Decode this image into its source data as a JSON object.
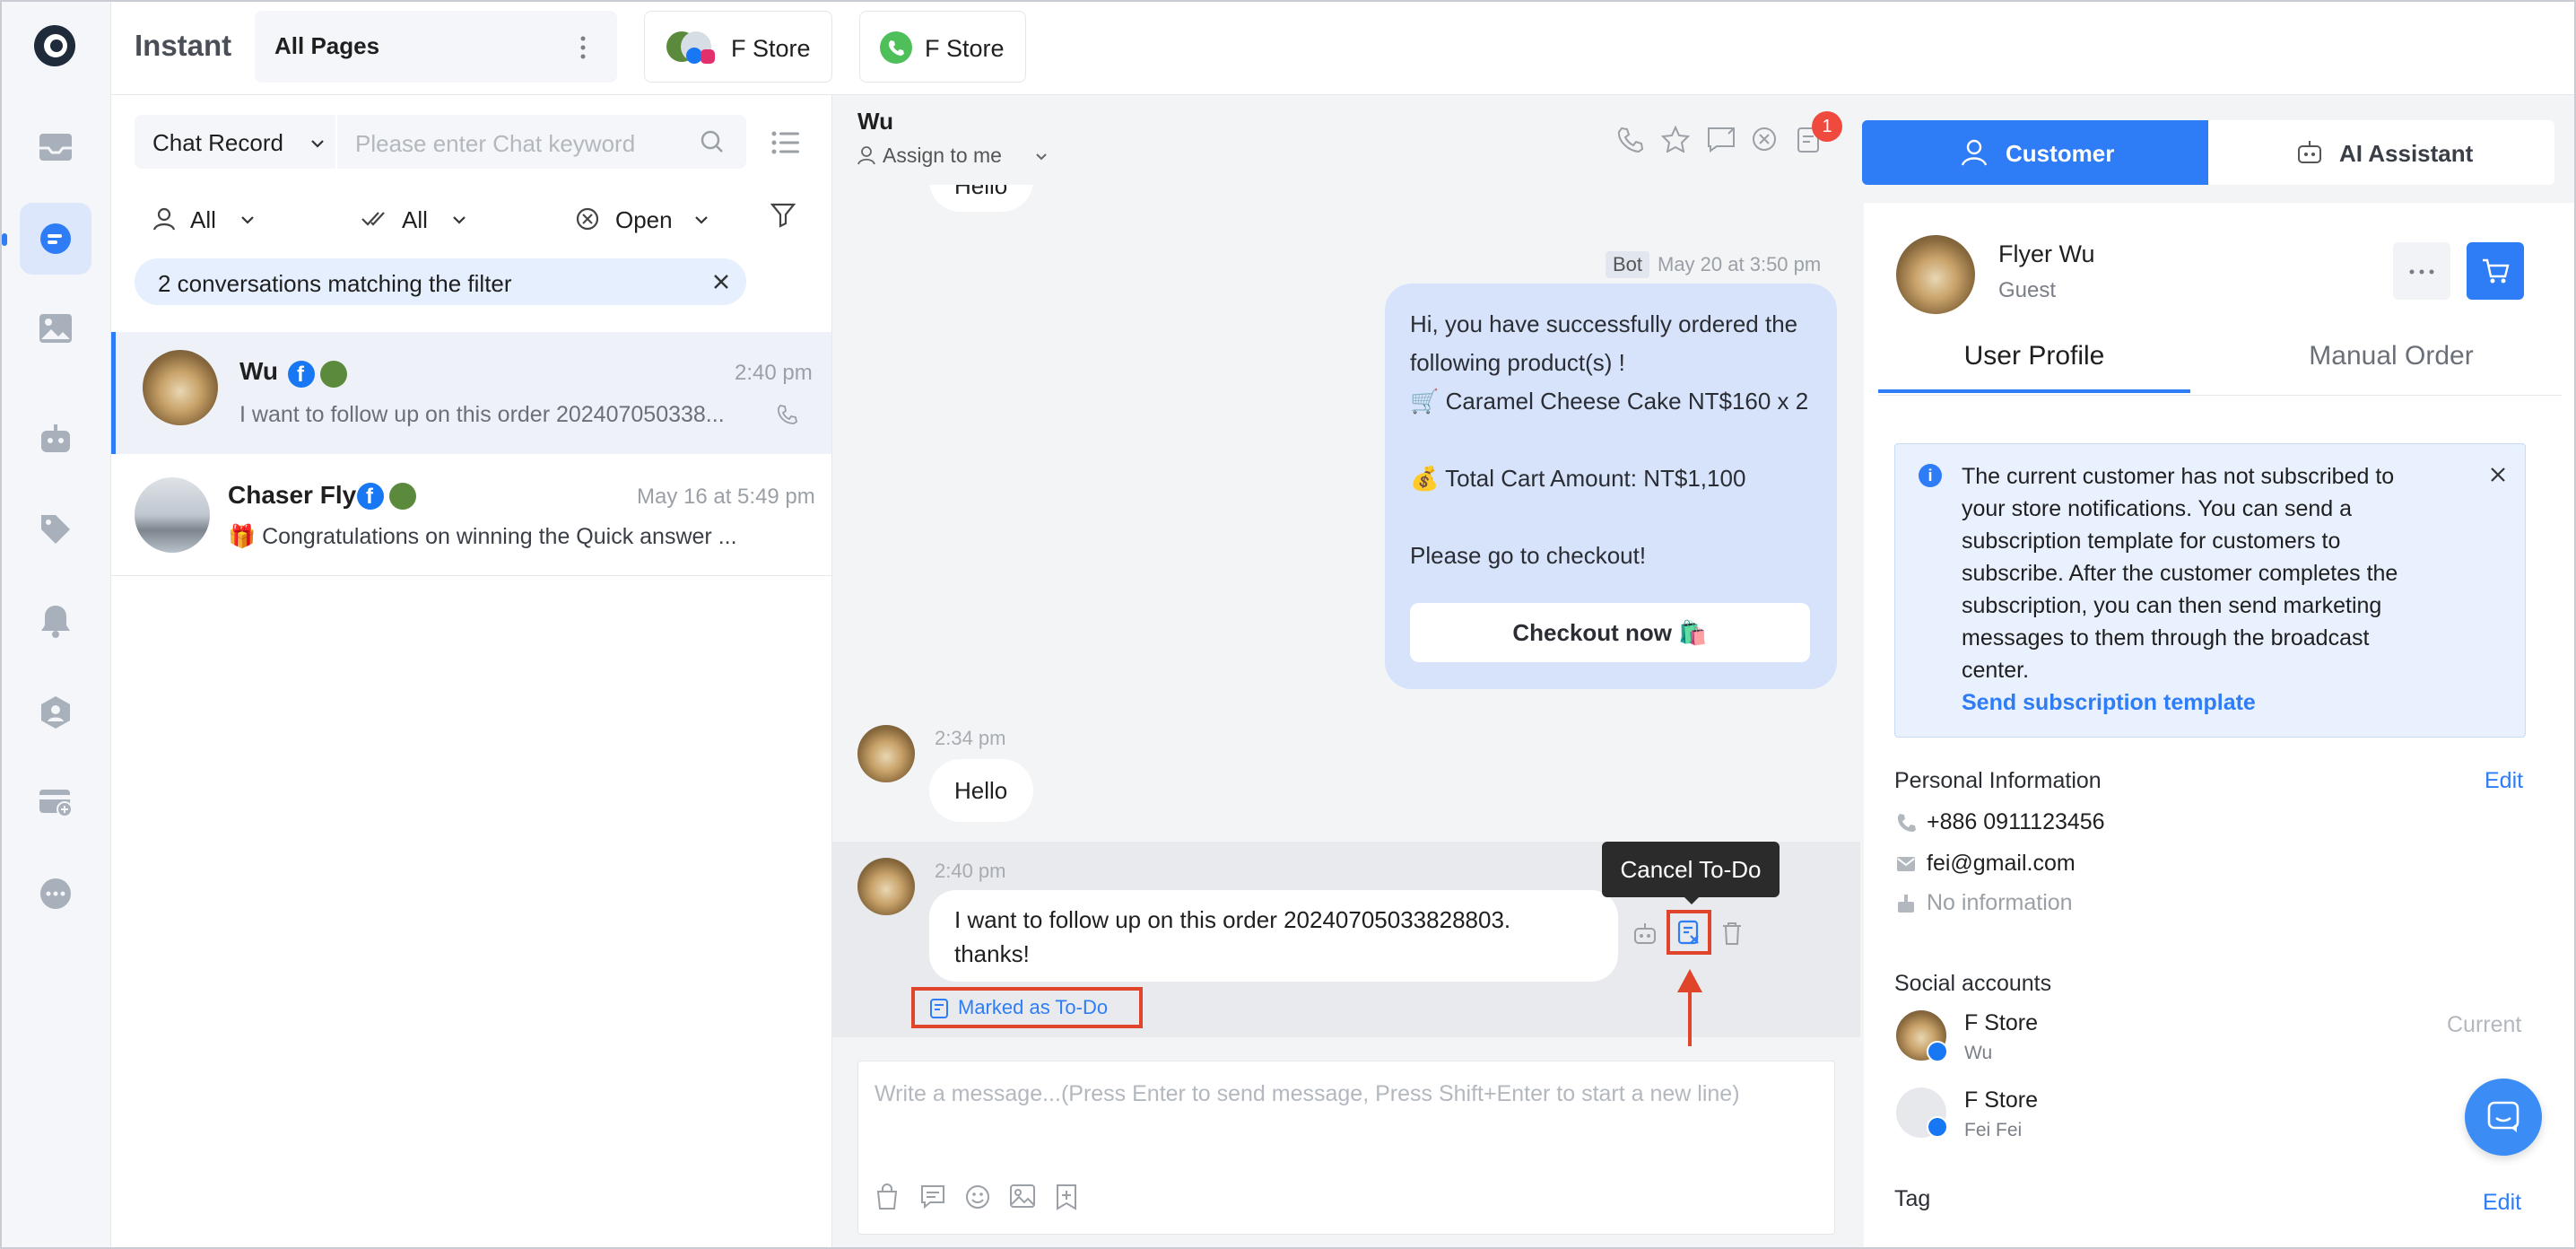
{
  "app": {
    "title": "Instant"
  },
  "top_tabs": {
    "pages_label": "All Pages",
    "store_tab_1": "F Store",
    "store_tab_2": "F Store"
  },
  "sidebar_icons": [
    "inbox-icon",
    "chat-icon",
    "image-icon",
    "bot-icon",
    "tag-icon",
    "bell-icon",
    "team-icon",
    "store-add-icon",
    "more-icon"
  ],
  "list_panel": {
    "record_type": "Chat Record",
    "search_placeholder": "Please enter Chat keyword",
    "filter_assignee": "All",
    "filter_read": "All",
    "filter_status": "Open",
    "match_banner": "2 conversations matching the filter",
    "conversations": [
      {
        "name": "Wu",
        "time": "2:40 pm",
        "preview": "I want to follow up on this order 202407050338..."
      },
      {
        "name": "Chaser Fly",
        "time": "May 16 at 5:49 pm",
        "preview": "🎁 Congratulations on winning the Quick answer   ..."
      }
    ]
  },
  "chat": {
    "contact_name": "Wu",
    "assign_label": "Assign to me",
    "todo_badge": "1",
    "top_bubble_fragment": "Hello",
    "bot_tag": "Bot",
    "bot_time": "May 20 at 3:50 pm",
    "bot_lines": [
      "Hi, you have successfully ordered the",
      "following product(s) !",
      "🛒 Caramel Cheese Cake NT$160 x 2",
      "💰 Total Cart Amount: NT$1,100",
      "Please go to checkout!"
    ],
    "checkout_button": "Checkout now 🛍️",
    "msg1_time": "2:34 pm",
    "msg1_text": "Hello",
    "msg2_time": "2:40 pm",
    "msg2_line1": "I want to follow up on this order 20240705033828803.",
    "msg2_line2": "thanks!",
    "tooltip": "Cancel To-Do",
    "marked_todo": "Marked as To-Do",
    "composer_placeholder": "Write a message...(Press Enter to send message, Press Shift+Enter to start a new line)"
  },
  "right_panel": {
    "tab_customer": "Customer",
    "tab_ai": "AI Assistant",
    "customer_name": "Flyer Wu",
    "customer_role": "Guest",
    "subtab_profile": "User Profile",
    "subtab_order": "Manual Order",
    "notice_lines": [
      "The current customer has not subscribed to",
      "your store notifications. You can send a",
      "subscription template for customers to",
      "subscribe. After the customer completes the",
      "subscription, you can then send marketing",
      "messages to them through the broadcast",
      "center."
    ],
    "notice_link": "Send subscription template",
    "personal_info_title": "Personal Information",
    "edit_label": "Edit",
    "phone": "+886 0911123456",
    "email": "fei@gmail.com",
    "birthday": "No information",
    "social_title": "Social accounts",
    "social": [
      {
        "store": "F Store",
        "user": "Wu",
        "status": "Current"
      },
      {
        "store": "F Store",
        "user": "Fei Fei",
        "status": ""
      }
    ],
    "tag_title": "Tag",
    "tag_edit": "Edit"
  },
  "colors": {
    "accent": "#2e7cf6",
    "highlight_red": "#e0452b",
    "badge_red": "#f04a3e"
  }
}
